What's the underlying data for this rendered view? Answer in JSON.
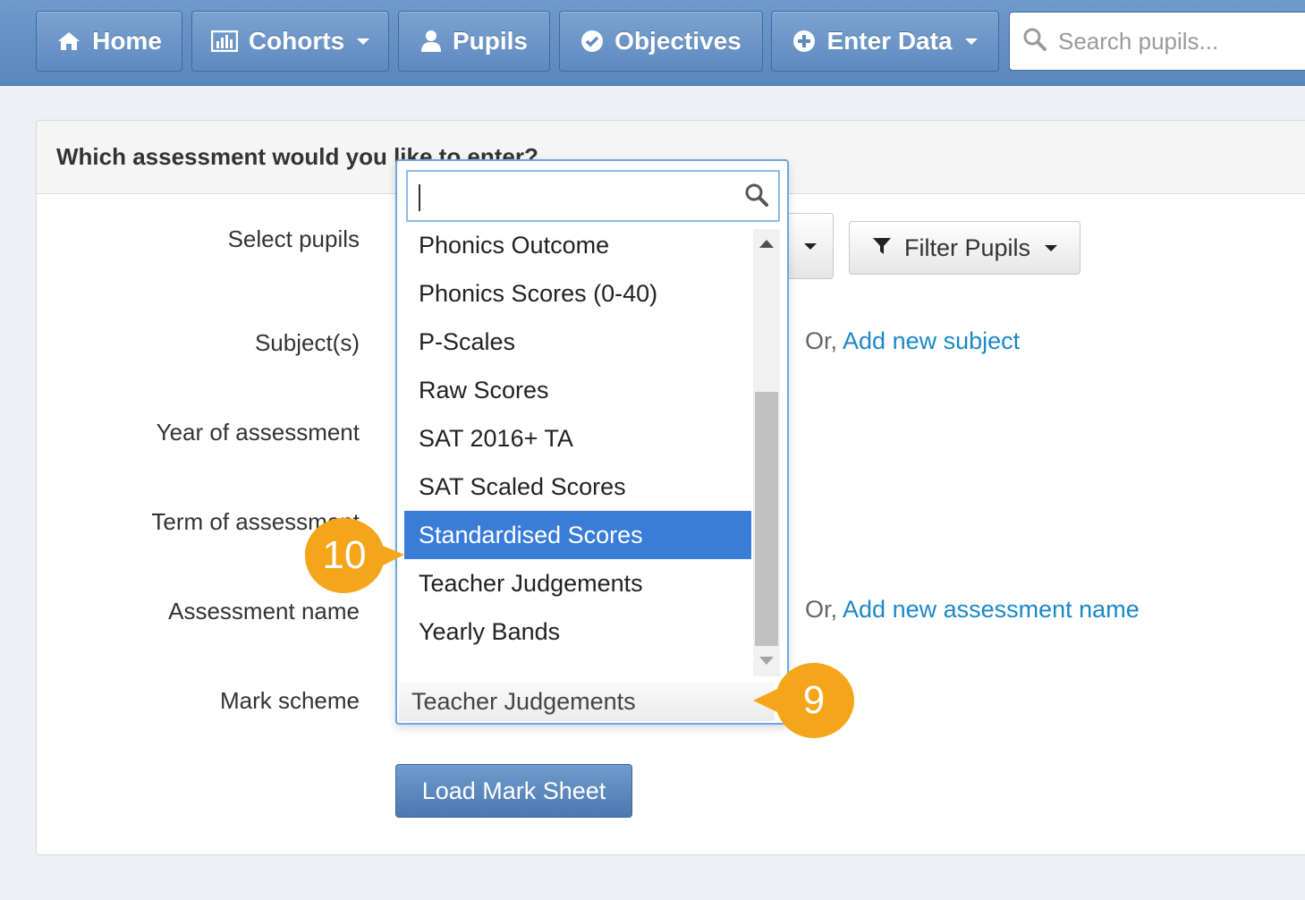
{
  "nav": {
    "home": "Home",
    "cohorts": "Cohorts",
    "pupils": "Pupils",
    "objectives": "Objectives",
    "enter_data": "Enter Data",
    "search_placeholder": "Search pupils..."
  },
  "panel": {
    "heading": "Which assessment would you like to enter?"
  },
  "form": {
    "select_pupils_label": "Select pupils",
    "subjects_label": "Subject(s)",
    "year_label": "Year of assessment",
    "term_label": "Term of assessment",
    "assessment_name_label": "Assessment name",
    "mark_scheme_label": "Mark scheme",
    "filter_pupils": "Filter Pupils",
    "or_prefix_subject": "Or, ",
    "add_subject_link": "Add new subject",
    "or_prefix_assessment": "Or, ",
    "add_assessment_link": "Add new assessment name",
    "load_button": "Load Mark Sheet"
  },
  "dropdown": {
    "search_value": "",
    "items": [
      "Phonics Outcome",
      "Phonics Scores (0-40)",
      "P-Scales",
      "Raw Scores",
      "SAT 2016+ TA",
      "SAT Scaled Scores",
      "Standardised Scores",
      "Teacher Judgements",
      "Yearly Bands"
    ],
    "highlighted_item": "Standardised Scores",
    "current_value": "Teacher Judgements"
  },
  "callouts": {
    "step_a": "10",
    "step_b": "9"
  },
  "colors": {
    "navbar": "#5f8ac0",
    "highlight": "#3a7dd8",
    "link": "#1a88c9",
    "callout": "#f5a519"
  }
}
